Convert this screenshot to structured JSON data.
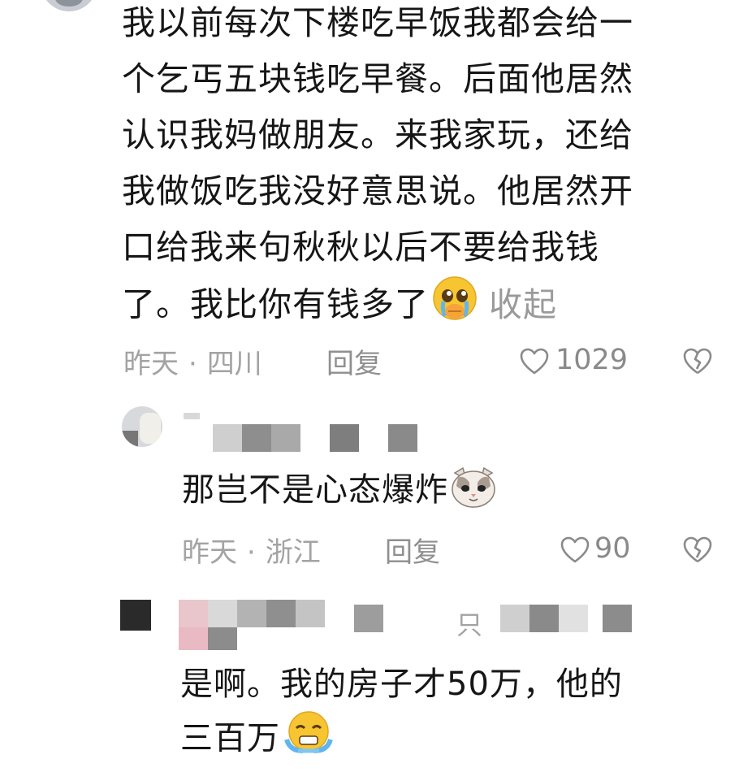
{
  "comment": {
    "lines": [
      "我以前每次下楼吃早饭我都会给一",
      "个乞丐五块钱吃早餐。后面他居然",
      "认识我妈做朋友。来我家玩，还给",
      "我做饭吃我没好意思说。他居然开",
      "口给我来句秋秋以后不要给我钱",
      "了。我比你有钱多了"
    ],
    "collapse_label": "收起",
    "time": "昨天",
    "location": "四川",
    "reply_label": "回复",
    "likes": "1029",
    "emoji": "crying-pleading-emoji"
  },
  "reply1": {
    "text": "那岂不是心态爆炸",
    "time": "昨天",
    "location": "浙江",
    "reply_label": "回复",
    "likes": "90",
    "emoji": "cat-face-emoji"
  },
  "reply2": {
    "name_partial": "只",
    "lines": [
      "是啊。我的房子才50万，他的",
      "三百万"
    ],
    "emoji": "crying-face-emoji"
  },
  "colors": {
    "text": "#161616",
    "meta": "#a3a3a3",
    "emoji_yellow": "#f7c531"
  }
}
